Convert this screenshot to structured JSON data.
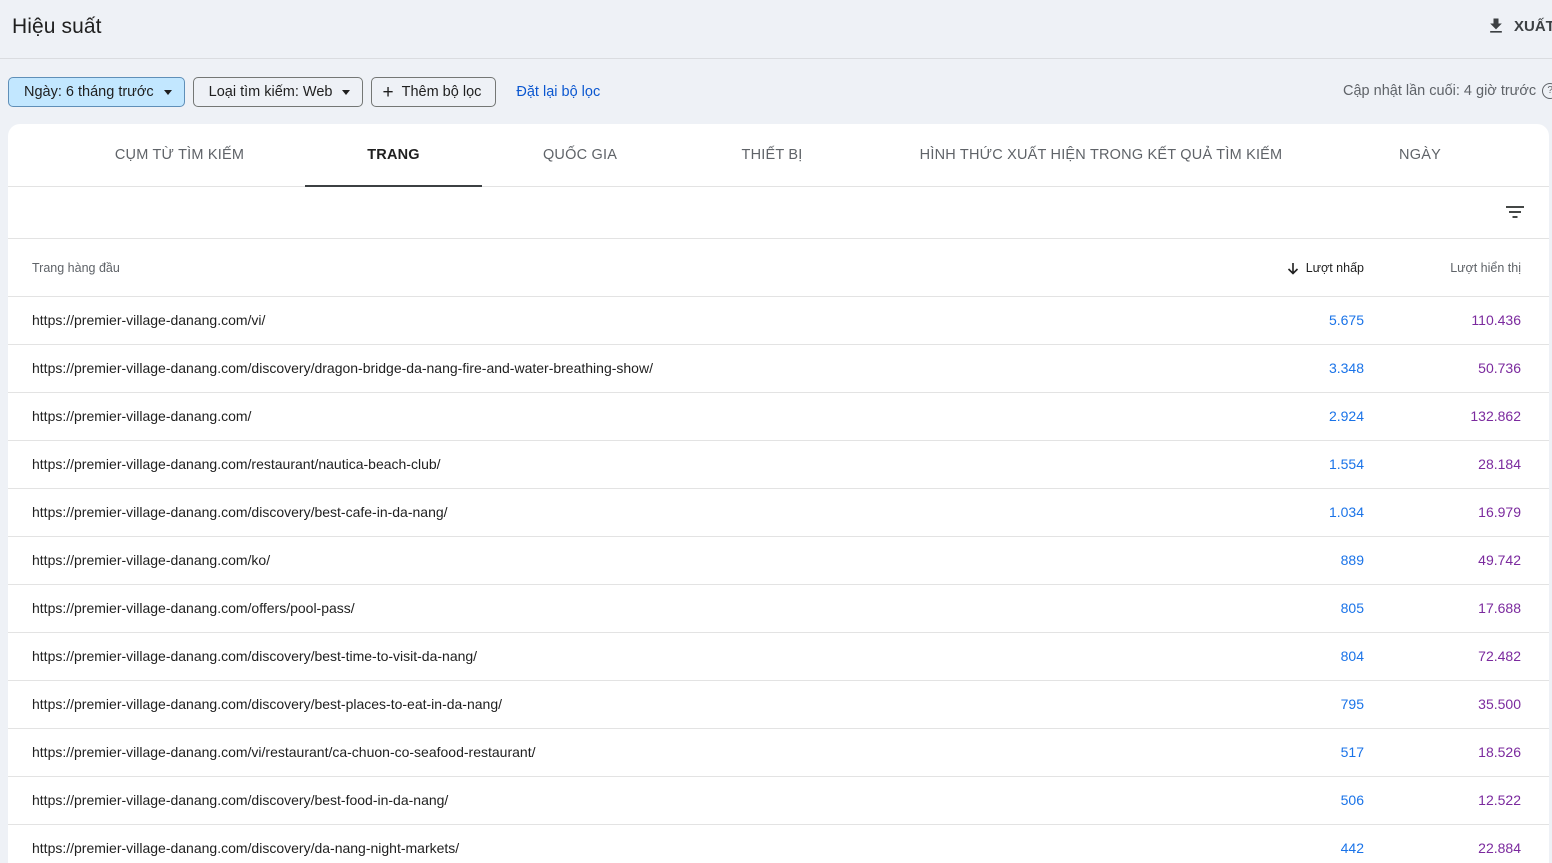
{
  "header": {
    "title": "Hiệu suất",
    "export_label": "XUẤT"
  },
  "filters": {
    "date": "Ngày: 6 tháng trước",
    "search_type": "Loại tìm kiếm: Web",
    "add_filter": "Thêm bộ lọc",
    "reset": "Đặt lại bộ lọc",
    "last_updated": "Cập nhật lần cuối: 4 giờ trước"
  },
  "tabs": [
    {
      "label": "CỤM TỪ TÌM KIẾM",
      "active": false
    },
    {
      "label": "TRANG",
      "active": true
    },
    {
      "label": "QUỐC GIA",
      "active": false
    },
    {
      "label": "THIẾT BỊ",
      "active": false
    },
    {
      "label": "HÌNH THỨC XUẤT HIỆN TRONG KẾT QUẢ TÌM KIẾM",
      "active": false
    },
    {
      "label": "NGÀY",
      "active": false
    }
  ],
  "table": {
    "columns": {
      "page": "Trang hàng đầu",
      "clicks": "Lượt nhấp",
      "impressions": "Lượt hiển thị"
    },
    "rows": [
      {
        "url": "https://premier-village-danang.com/vi/",
        "clicks": "5.675",
        "impressions": "110.436"
      },
      {
        "url": "https://premier-village-danang.com/discovery/dragon-bridge-da-nang-fire-and-water-breathing-show/",
        "clicks": "3.348",
        "impressions": "50.736"
      },
      {
        "url": "https://premier-village-danang.com/",
        "clicks": "2.924",
        "impressions": "132.862"
      },
      {
        "url": "https://premier-village-danang.com/restaurant/nautica-beach-club/",
        "clicks": "1.554",
        "impressions": "28.184"
      },
      {
        "url": "https://premier-village-danang.com/discovery/best-cafe-in-da-nang/",
        "clicks": "1.034",
        "impressions": "16.979"
      },
      {
        "url": "https://premier-village-danang.com/ko/",
        "clicks": "889",
        "impressions": "49.742"
      },
      {
        "url": "https://premier-village-danang.com/offers/pool-pass/",
        "clicks": "805",
        "impressions": "17.688"
      },
      {
        "url": "https://premier-village-danang.com/discovery/best-time-to-visit-da-nang/",
        "clicks": "804",
        "impressions": "72.482"
      },
      {
        "url": "https://premier-village-danang.com/discovery/best-places-to-eat-in-da-nang/",
        "clicks": "795",
        "impressions": "35.500"
      },
      {
        "url": "https://premier-village-danang.com/vi/restaurant/ca-chuon-co-seafood-restaurant/",
        "clicks": "517",
        "impressions": "18.526"
      },
      {
        "url": "https://premier-village-danang.com/discovery/best-food-in-da-nang/",
        "clicks": "506",
        "impressions": "12.522"
      },
      {
        "url": "https://premier-village-danang.com/discovery/da-nang-night-markets/",
        "clicks": "442",
        "impressions": "22.884"
      }
    ]
  },
  "colors": {
    "clicks": "#1a73e8",
    "impressions": "#7b2a9e",
    "active_chip": "#c2e7ff",
    "link": "#0b57d0"
  },
  "icons": {
    "export": "download-icon",
    "date_dropdown": "caret-down-icon",
    "add_filter": "plus-icon",
    "help": "help-circle-icon",
    "table_filter": "filter-list-icon",
    "sort": "arrow-down-icon"
  }
}
